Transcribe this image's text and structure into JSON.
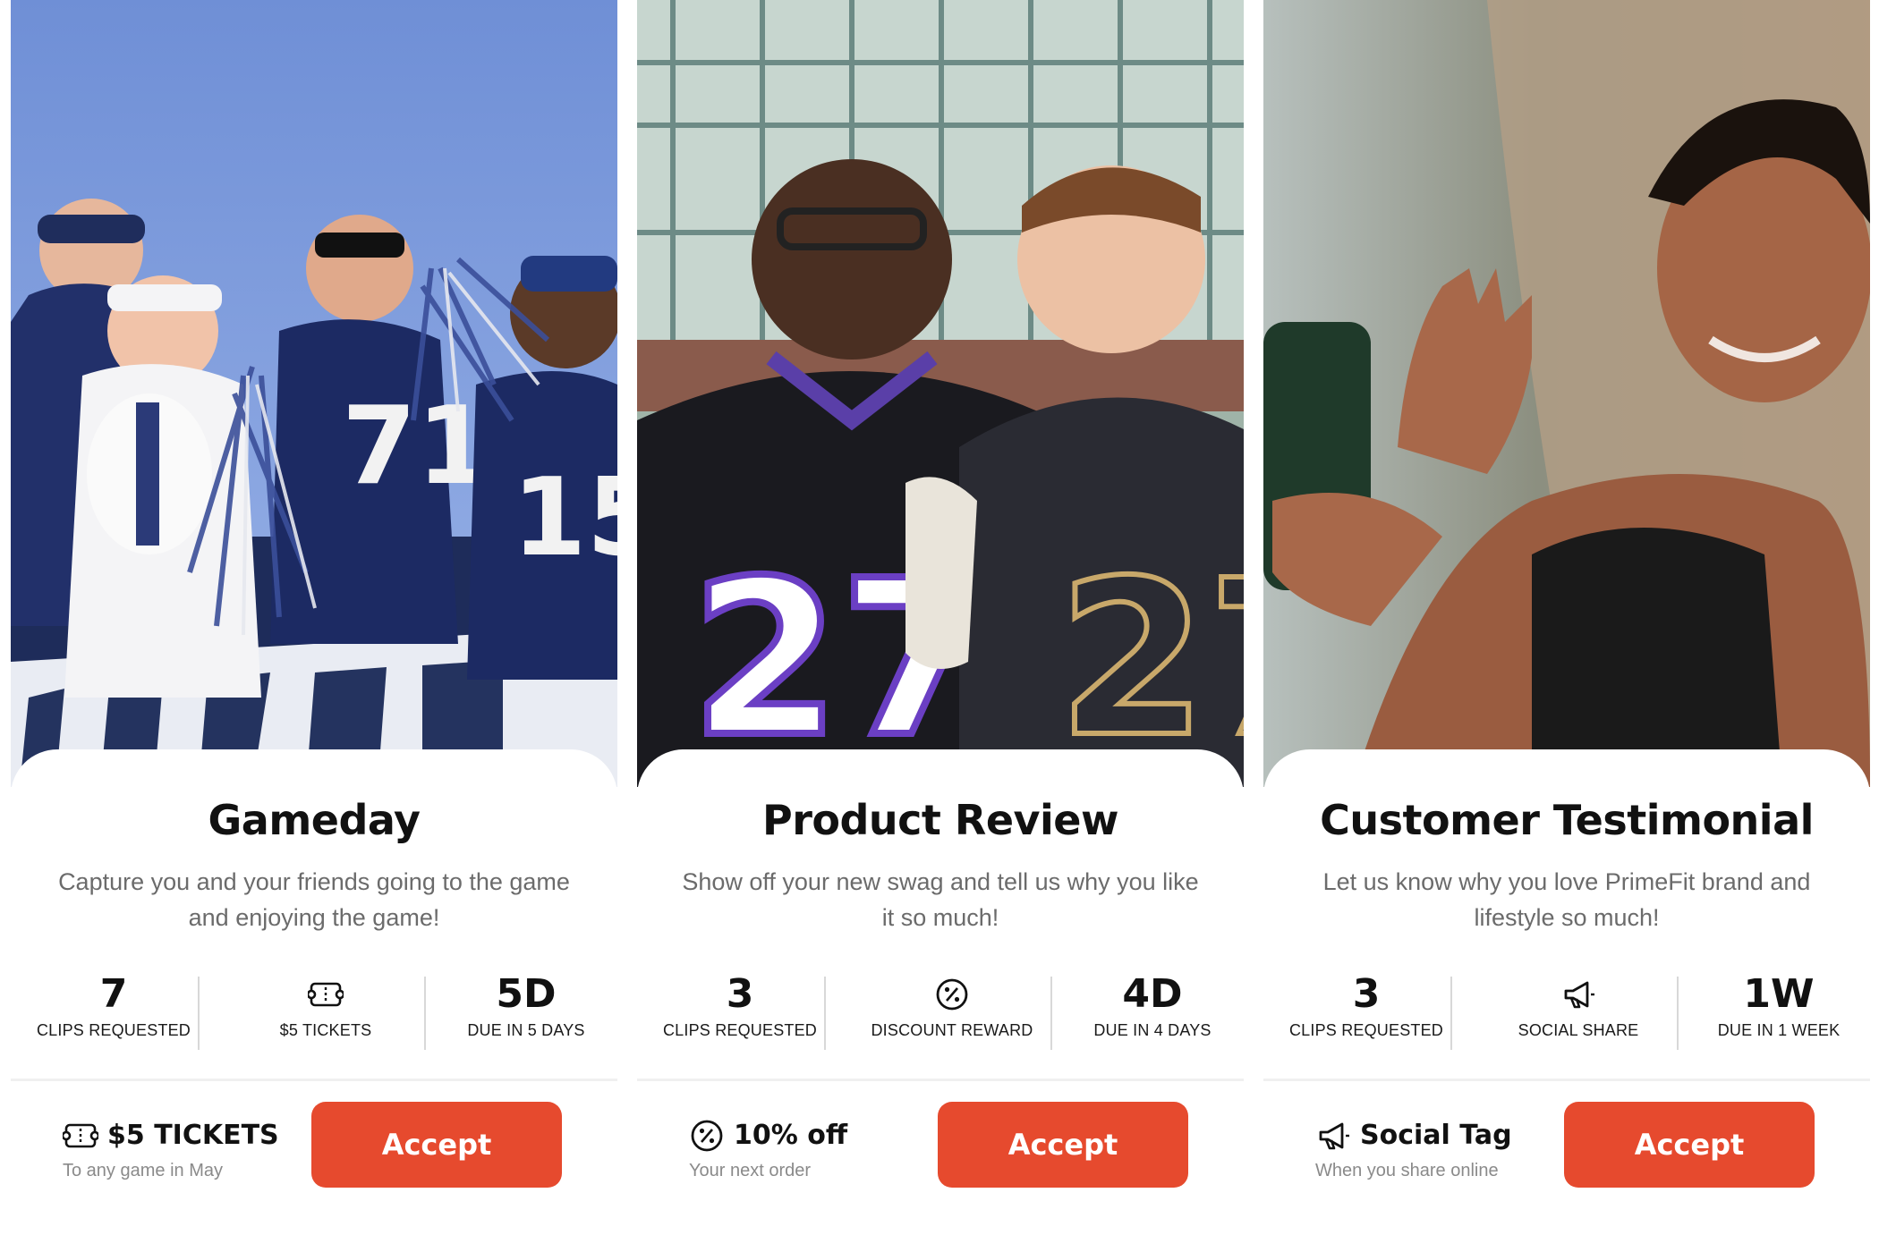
{
  "colors": {
    "accent": "#e64a2e",
    "title_text": "#111111",
    "description_text": "#6b6b6b",
    "subtext": "#8a8a8a",
    "divider": "#d8d8d8"
  },
  "cards": [
    {
      "photo": "fans-cheering-in-stadium-stands",
      "title": "Gameday",
      "description": "Capture you and your friends going to the game and enjoying the game!",
      "stats": [
        {
          "value": "7",
          "label": "CLIPS REQUESTED"
        },
        {
          "icon": "ticket-icon",
          "label": "$5 TICKETS"
        },
        {
          "value": "5D",
          "label": "DUE IN 5 DAYS"
        }
      ],
      "reward": {
        "icon": "ticket-icon",
        "title": "$5 TICKETS",
        "subtitle": "To any game in May"
      },
      "accept_label": "Accept"
    },
    {
      "photo": "two-fans-holding-jerseys",
      "title": "Product Review",
      "description": "Show off your new swag and tell us why you like it so much!",
      "stats": [
        {
          "value": "3",
          "label": "CLIPS REQUESTED"
        },
        {
          "icon": "percent-badge-icon",
          "label": "DISCOUNT REWARD"
        },
        {
          "value": "4D",
          "label": "DUE IN 4 DAYS"
        }
      ],
      "reward": {
        "icon": "percent-badge-icon",
        "title": "10% off",
        "subtitle": "Your next order"
      },
      "accept_label": "Accept"
    },
    {
      "photo": "woman-waving-at-phone",
      "title": "Customer Testimonial",
      "description": "Let us know why you love PrimeFit brand and lifestyle so much!",
      "stats": [
        {
          "value": "3",
          "label": "CLIPS REQUESTED"
        },
        {
          "icon": "megaphone-icon",
          "label": "SOCIAL SHARE"
        },
        {
          "value": "1W",
          "label": "DUE IN 1 WEEK"
        }
      ],
      "reward": {
        "icon": "megaphone-icon",
        "title": "Social Tag",
        "subtitle": "When you share online"
      },
      "accept_label": "Accept"
    }
  ]
}
